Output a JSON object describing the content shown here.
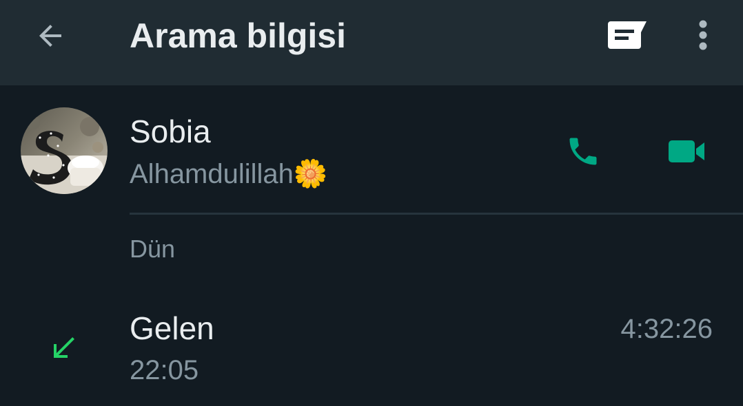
{
  "header": {
    "title": "Arama bilgisi",
    "back_icon": "arrow-left-icon",
    "note_icon": "new-message-icon",
    "menu_icon": "more-vertical-icon"
  },
  "contact": {
    "name": "Sobia",
    "status": "Alhamdulillah🌼",
    "voice_call_icon": "phone-icon",
    "video_call_icon": "video-camera-icon"
  },
  "calls": {
    "section_label": "Dün",
    "items": [
      {
        "type": "Gelen",
        "time": "22:05",
        "duration": "4:32:26",
        "direction_icon": "incoming-arrow-icon"
      }
    ]
  },
  "colors": {
    "background": "#121b22",
    "header": "#202c33",
    "accent": "#00a884",
    "incoming": "#25d366",
    "primary_text": "#e9edef",
    "secondary_text": "#8696a0"
  }
}
